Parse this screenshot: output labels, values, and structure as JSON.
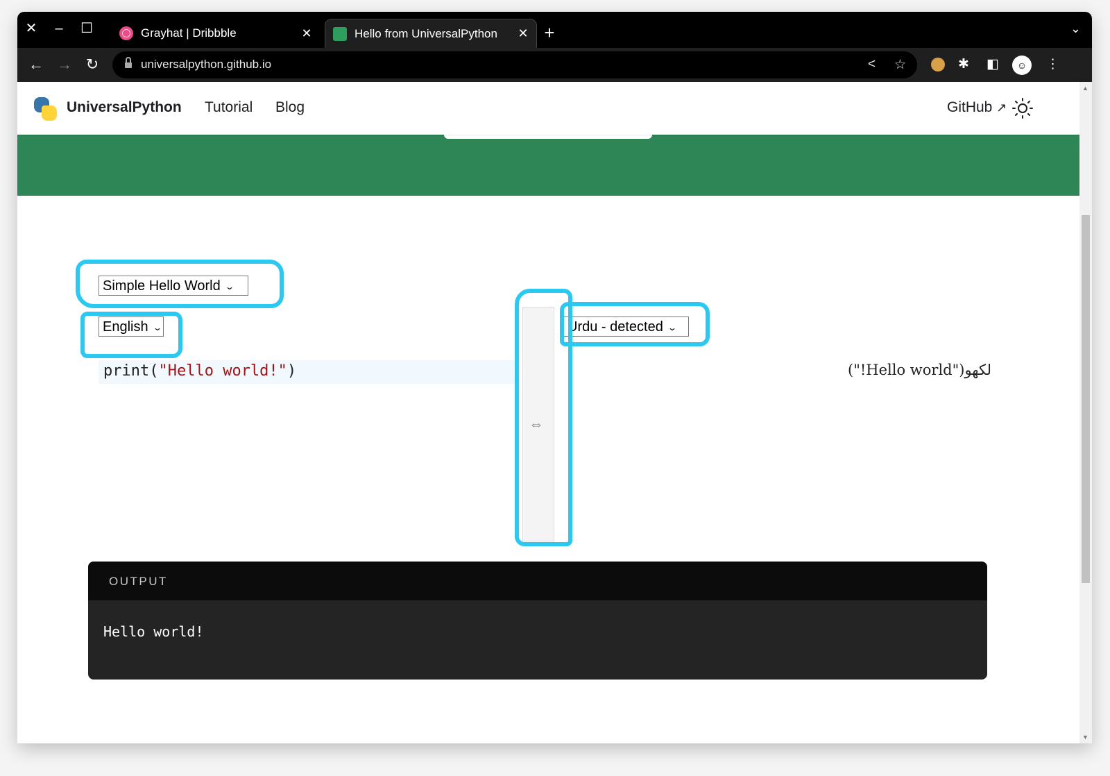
{
  "browser": {
    "tabs": [
      {
        "title": "Grayhat | Dribbble",
        "active": false
      },
      {
        "title": "Hello from UniversalPython",
        "active": true
      }
    ],
    "url": "universalpython.github.io"
  },
  "site": {
    "brand": "UniversalPython",
    "nav": [
      "Tutorial",
      "Blog"
    ],
    "github": "GitHub",
    "colors": {
      "hero": "#2e8555",
      "annotation": "#2bc8f2"
    }
  },
  "editor": {
    "example_select": "Simple Hello World",
    "source_language": "English",
    "target_language": "Urdu - detected",
    "code": {
      "prefix": "print(",
      "string": "\"Hello world!\"",
      "suffix": ")"
    },
    "translated": "لکھو(\"Hello world!\")",
    "divider_glyph": "⇔"
  },
  "output": {
    "header": "OUTPUT",
    "text": "Hello world!"
  }
}
